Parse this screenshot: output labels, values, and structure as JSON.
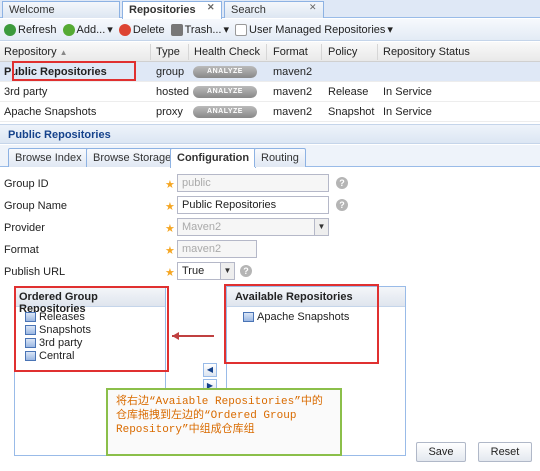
{
  "tabs": [
    {
      "label": "Welcome"
    },
    {
      "label": "Repositories"
    },
    {
      "label": "Search"
    }
  ],
  "toolbar": {
    "refresh": "Refresh",
    "add": "Add...",
    "delete": "Delete",
    "trash": "Trash...",
    "user_managed": "User Managed Repositories"
  },
  "grid": {
    "columns": [
      "Repository",
      "Type",
      "Health Check",
      "Format",
      "Policy",
      "Repository Status"
    ],
    "analyze_label": "ANALYZE",
    "rows": [
      {
        "name": "Public Repositories",
        "type": "group",
        "format": "maven2",
        "policy": "",
        "status": ""
      },
      {
        "name": "3rd party",
        "type": "hosted",
        "format": "maven2",
        "policy": "Release",
        "status": "In Service"
      },
      {
        "name": "Apache Snapshots",
        "type": "proxy",
        "format": "maven2",
        "policy": "Snapshot",
        "status": "In Service"
      }
    ]
  },
  "detail": {
    "title": "Public Repositories",
    "subtabs": [
      "Browse Index",
      "Browse Storage",
      "Configuration",
      "Routing"
    ]
  },
  "form": {
    "group_id_label": "Group ID",
    "group_id_value": "public",
    "group_name_label": "Group Name",
    "group_name_value": "Public Repositories",
    "provider_label": "Provider",
    "provider_value": "Maven2",
    "format_label": "Format",
    "format_value": "maven2",
    "publish_url_label": "Publish URL",
    "publish_url_value": "True"
  },
  "ordered": {
    "title": "Ordered Group Repositories",
    "items": [
      "Releases",
      "Snapshots",
      "3rd party",
      "Central"
    ]
  },
  "available": {
    "title": "Available Repositories",
    "items": [
      "Apache Snapshots"
    ]
  },
  "note": {
    "line1": "将右边“Avaiable Repositories”中的",
    "line2": "仓库拖拽到左边的“Ordered Group",
    "line3": "Repository”中组成仓库组"
  },
  "buttons": {
    "save": "Save",
    "reset": "Reset"
  },
  "colors": {
    "highlight_border": "#e03030",
    "note_border": "#8bbf4a",
    "note_text": "#d96b00"
  }
}
